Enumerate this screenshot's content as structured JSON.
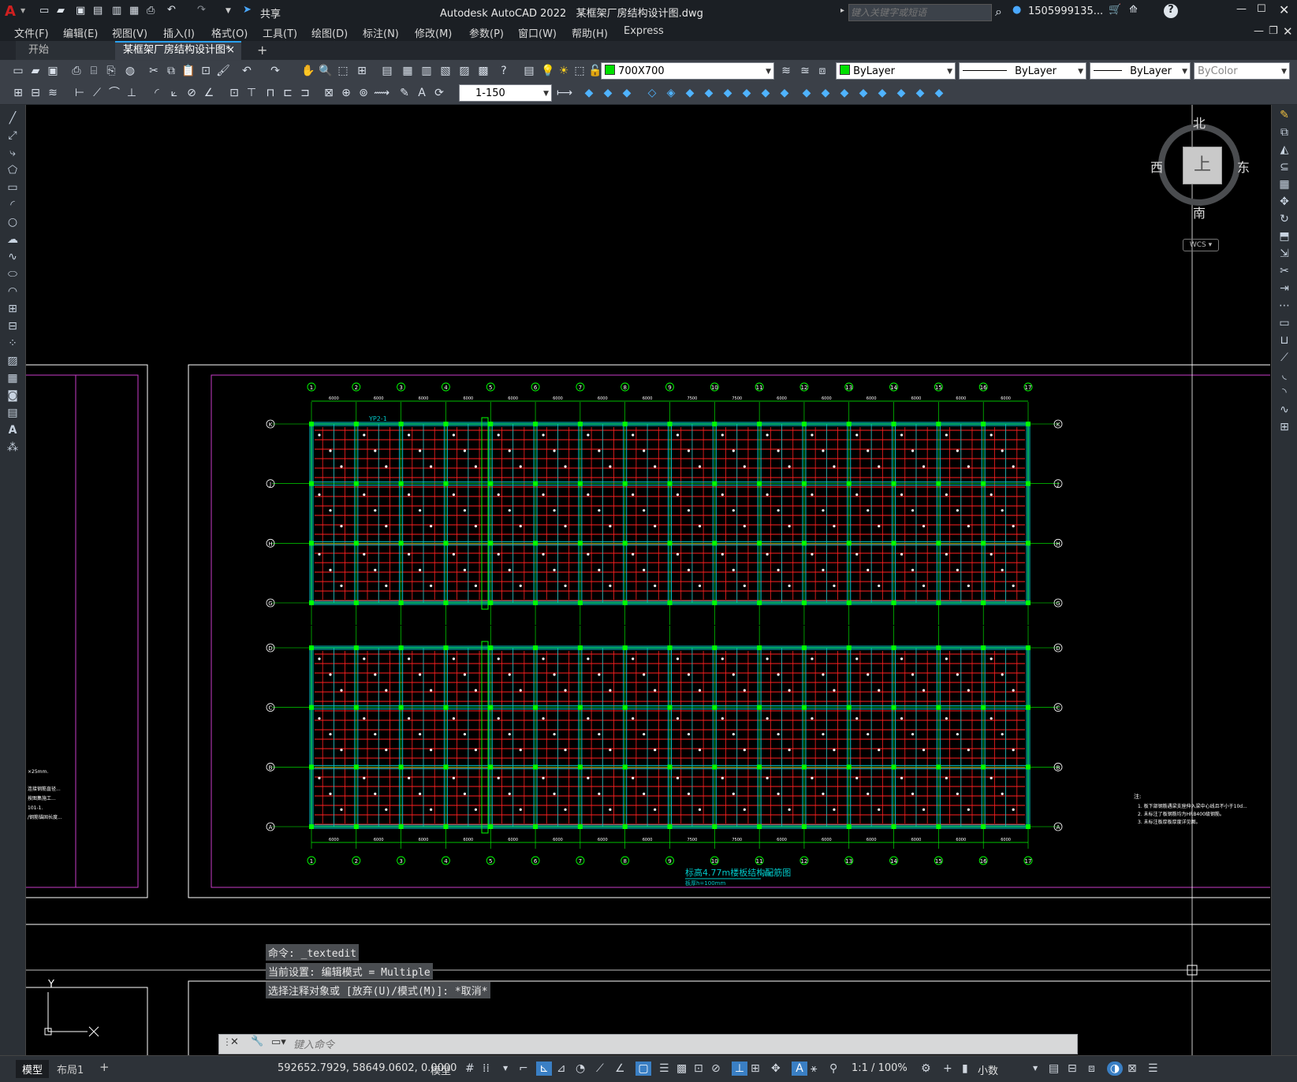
{
  "app": {
    "name": "Autodesk AutoCAD 2022",
    "file": "某框架厂房结构设计图.dwg"
  },
  "titlebar": {
    "share": "共享",
    "search_placeholder": "键入关键字或短语",
    "user": "1505999135...",
    "help": "?"
  },
  "menu": [
    "文件(F)",
    "编辑(E)",
    "视图(V)",
    "插入(I)",
    "格式(O)",
    "工具(T)",
    "绘图(D)",
    "标注(N)",
    "修改(M)",
    "参数(P)",
    "窗口(W)",
    "帮助(H)",
    "Express"
  ],
  "tabs": {
    "start": "开始",
    "active": "某框架厂房结构设计图*",
    "close": "×",
    "add": "+"
  },
  "toolbar1": {
    "layer_combo": "700X700",
    "color_combo": "ByLayer",
    "linetype_combo": "ByLayer",
    "lineweight_combo": "ByLayer",
    "plotstyle_combo": "ByColor"
  },
  "toolbar2": {
    "scale_combo": "1-150"
  },
  "viewcube": {
    "north": "北",
    "south": "南",
    "east": "东",
    "west": "西",
    "top": "上",
    "wcs": "WCS"
  },
  "ucs": {
    "y": "Y",
    "x": "X"
  },
  "command": {
    "history": [
      "命令: _textedit",
      "当前设置: 编辑模式 = Multiple",
      "选择注释对象或 [放弃(U)/模式(M)]: *取消*"
    ],
    "placeholder": "键入命令"
  },
  "drawing": {
    "axis_numbers": [
      "1",
      "2",
      "3",
      "4",
      "5",
      "6",
      "7",
      "8",
      "9",
      "10",
      "11",
      "12",
      "13",
      "14",
      "15",
      "16",
      "17"
    ],
    "axis_letters_top": [
      "K",
      "J",
      "H",
      "G"
    ],
    "axis_letters_bottom": [
      "D",
      "C",
      "B",
      "A"
    ],
    "span_labels": [
      "6000",
      "6000",
      "6000",
      "6000",
      "6000",
      "6000",
      "6000",
      "6000",
      "7500",
      "7500",
      "6000",
      "6000",
      "6000",
      "6000",
      "6000",
      "6000"
    ],
    "title": "标高4.77m楼板结构配筋图",
    "subtitle": "板厚h=100mm",
    "scale_note": "1:100",
    "beam_tag": "YP2-1",
    "notes_title": "注:",
    "notes": [
      "1. 板下部钢筋遇梁支座伸入梁中心线且不小于10d...",
      "2. 未标注了板钢筋均为HRB400级钢筋。",
      "3. 未标注板厚板厚度详见图。"
    ],
    "left_notes": [
      "×25mm.",
      "连接钢筋直径...",
      "按图集施工...",
      "101-1.",
      "/钢筋锚固长度..."
    ]
  },
  "status": {
    "model_tab": "模型",
    "layout_tab": "布局1",
    "add": "+",
    "coords": "592652.7929, 58649.0602, 0.0000",
    "space": "模型",
    "scale": "1:1 / 100%",
    "units": "小数"
  },
  "colors": {
    "accent": "#2aa1f0",
    "bg": "#000000",
    "grid_green": "#00ff00",
    "beam_cyan": "#00c8c8",
    "rebar_red": "#ff2020",
    "frame_magenta": "#c83cc8"
  }
}
